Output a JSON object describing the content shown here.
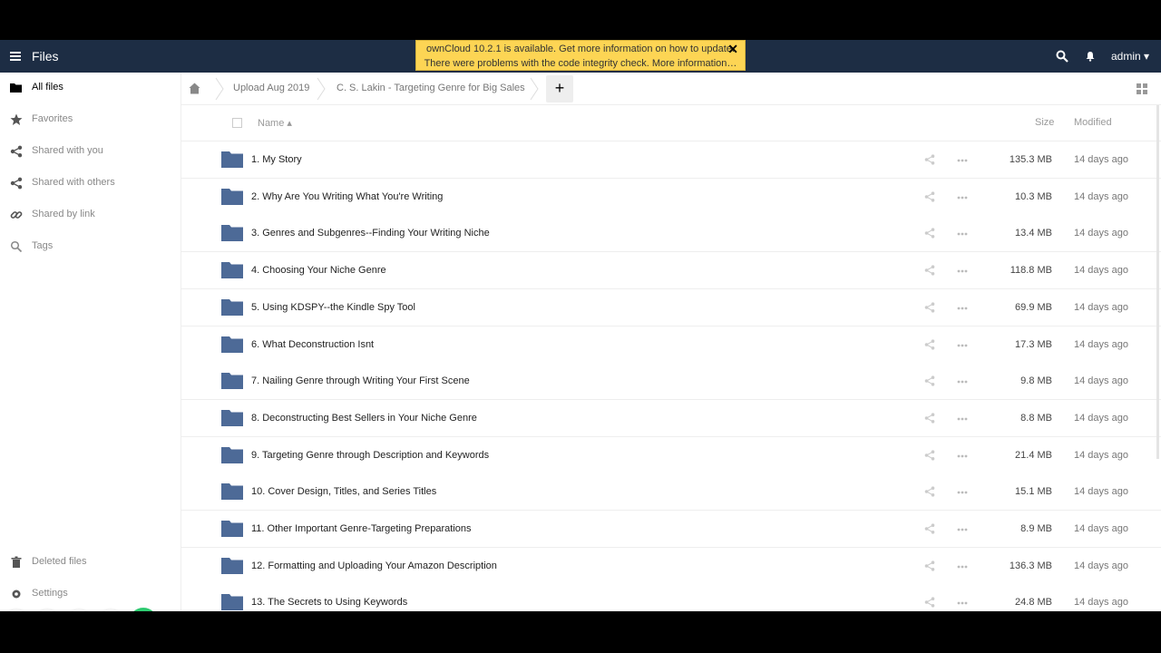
{
  "header": {
    "app_title": "Files",
    "notice_line1": "ownCloud 10.2.1 is available. Get more information on how to update.",
    "notice_line2": "There were problems with the code integrity check. More information…",
    "notice_close": "✕",
    "user_label": "admin ▾"
  },
  "sidebar": {
    "items": [
      {
        "label": "All files",
        "icon": "folder-icon"
      },
      {
        "label": "Favorites",
        "icon": "star-icon"
      },
      {
        "label": "Shared with you",
        "icon": "share-icon"
      },
      {
        "label": "Shared with others",
        "icon": "share-icon"
      },
      {
        "label": "Shared by link",
        "icon": "link-icon"
      },
      {
        "label": "Tags",
        "icon": "tag-icon"
      }
    ],
    "deleted_label": "Deleted files",
    "settings_label": "Settings"
  },
  "breadcrumb": {
    "items": [
      "Upload Aug 2019",
      "C. S. Lakin - Targeting Genre for Big Sales"
    ],
    "new_label": "+"
  },
  "list_header": {
    "name": "Name ▴",
    "size": "Size",
    "modified": "Modified"
  },
  "files": [
    {
      "name": "1. My Story",
      "size": "135.3 MB",
      "modified": "14 days ago"
    },
    {
      "name": "2. Why Are You Writing What You're Writing",
      "size": "10.3 MB",
      "modified": "14 days ago"
    },
    {
      "name": "3. Genres and Subgenres--Finding Your Writing Niche",
      "size": "13.4 MB",
      "modified": "14 days ago"
    },
    {
      "name": "4. Choosing Your Niche Genre",
      "size": "118.8 MB",
      "modified": "14 days ago"
    },
    {
      "name": "5. Using KDSPY--the Kindle Spy Tool",
      "size": "69.9 MB",
      "modified": "14 days ago"
    },
    {
      "name": "6. What Deconstruction Isnt",
      "size": "17.3 MB",
      "modified": "14 days ago"
    },
    {
      "name": "7. Nailing Genre through Writing Your First Scene",
      "size": "9.8 MB",
      "modified": "14 days ago"
    },
    {
      "name": "8. Deconstructing Best Sellers in Your Niche Genre",
      "size": "8.8 MB",
      "modified": "14 days ago"
    },
    {
      "name": "9. Targeting Genre through Description and Keywords",
      "size": "21.4 MB",
      "modified": "14 days ago"
    },
    {
      "name": "10. Cover Design, Titles, and Series Titles",
      "size": "15.1 MB",
      "modified": "14 days ago"
    },
    {
      "name": "11. Other Important Genre-Targeting Preparations",
      "size": "8.9 MB",
      "modified": "14 days ago"
    },
    {
      "name": "12. Formatting and Uploading Your Amazon Description",
      "size": "136.3 MB",
      "modified": "14 days ago"
    },
    {
      "name": "13. The Secrets to Using Keywords",
      "size": "24.8 MB",
      "modified": "14 days ago"
    }
  ],
  "colors": {
    "header_bg": "#1d2d44",
    "notice_bg": "#fdd554",
    "folder": "#4d6a97",
    "confirm": "#2ecc71"
  }
}
